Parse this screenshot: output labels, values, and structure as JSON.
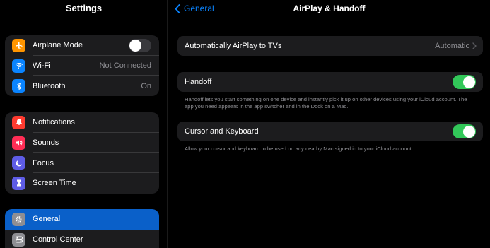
{
  "sidebar": {
    "title": "Settings",
    "group1": [
      {
        "label": "Airplane Mode",
        "icon": "airplane-icon",
        "color": "#ff9500"
      },
      {
        "label": "Wi-Fi",
        "value": "Not Connected",
        "icon": "wifi-icon",
        "color": "#0a84ff"
      },
      {
        "label": "Bluetooth",
        "value": "On",
        "icon": "bluetooth-icon",
        "color": "#0a84ff"
      }
    ],
    "group2": [
      {
        "label": "Notifications",
        "icon": "bell-icon",
        "color": "#ff3b30"
      },
      {
        "label": "Sounds",
        "icon": "speaker-icon",
        "color": "#ff2d55"
      },
      {
        "label": "Focus",
        "icon": "moon-icon",
        "color": "#5e5ce6"
      },
      {
        "label": "Screen Time",
        "icon": "hourglass-icon",
        "color": "#5e5ce6"
      }
    ],
    "group3": [
      {
        "label": "General",
        "icon": "gear-icon",
        "color": "#8e8e93"
      },
      {
        "label": "Control Center",
        "icon": "toggles-icon",
        "color": "#8e8e93"
      }
    ]
  },
  "main": {
    "back_label": "General",
    "title": "AirPlay & Handoff",
    "airplay": {
      "label": "Automatically AirPlay to TVs",
      "value": "Automatic"
    },
    "handoff": {
      "label": "Handoff",
      "footnote": "Handoff lets you start something on one device and instantly pick it up on other devices using your iCloud account. The app you need appears in the app switcher and in the Dock on a Mac."
    },
    "cursor": {
      "label": "Cursor and Keyboard",
      "footnote": "Allow your cursor and keyboard to be used on any nearby Mac signed in to your iCloud account."
    }
  },
  "colors": {
    "accent": "#0a84ff",
    "toggle_on": "#32c759",
    "selected": "#0a60c9"
  }
}
